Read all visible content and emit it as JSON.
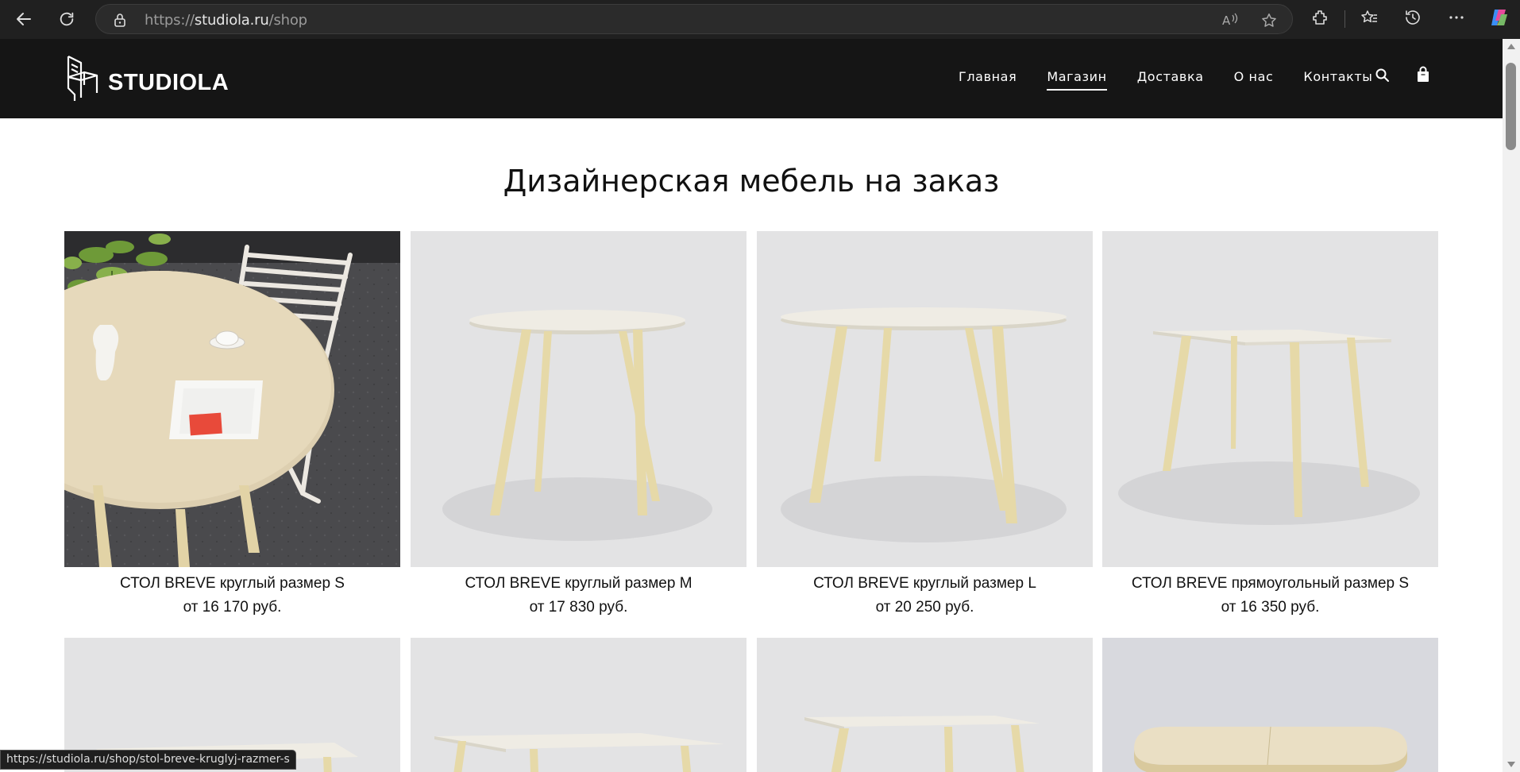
{
  "browser": {
    "url_prefix": "https://",
    "url_host": "studiola.ru",
    "url_path": "/shop",
    "status_url": "https://studiola.ru/shop/stol-breve-kruglyj-razmer-s"
  },
  "site": {
    "logo_text": "STUDIOLA",
    "nav": [
      "Главная",
      "Магазин",
      "Доставка",
      "О нас",
      "Контакты"
    ],
    "active_nav": "Магазин"
  },
  "page": {
    "title": "Дизайнерская мебель на заказ"
  },
  "products": [
    {
      "name": "СТОЛ BREVE круглый размер S",
      "price": "от  16 170 руб."
    },
    {
      "name": "СТОЛ BREVE круглый размер M",
      "price": "от  17 830 руб."
    },
    {
      "name": "СТОЛ BREVE круглый размер L",
      "price": "от  20 250 руб."
    },
    {
      "name": "СТОЛ BREVE прямоугольный размер S",
      "price": "от  16 350 руб."
    }
  ],
  "colors": {
    "header_bg": "#151515",
    "product_bg": "#e2e2e2",
    "wood": "#e6d9a8",
    "tabletop": "#efece4"
  }
}
